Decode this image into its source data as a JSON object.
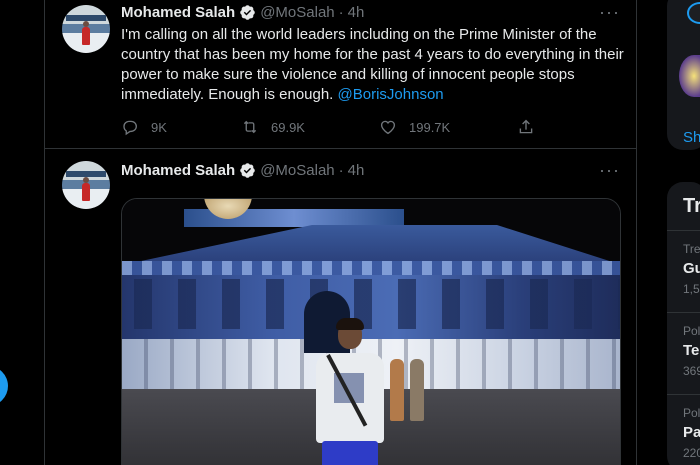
{
  "tweets": [
    {
      "name": "Mohamed Salah",
      "handle": "@MoSalah",
      "separator": "·",
      "time": "4h",
      "text": "I'm calling on all the world leaders including on the Prime Minister of the country that has been my home for the past 4 years to do everything in their power to make sure the violence and killing of innocent people stops immediately. Enough is enough.",
      "mention": "@BorisJohnson",
      "replies": "9K",
      "retweets": "69.9K",
      "likes": "199.7K",
      "more": "···"
    },
    {
      "name": "Mohamed Salah",
      "handle": "@MoSalah",
      "separator": "·",
      "time": "4h",
      "more": "···"
    }
  ],
  "right_sidebar": {
    "show_more_fragment": "Sh",
    "trends_heading_fragment": "Tr",
    "trends": [
      {
        "context": "Tre",
        "title": "Gu",
        "count": "1,5"
      },
      {
        "context": "Pol",
        "title": "Te",
        "count": "369"
      },
      {
        "context": "Pol",
        "title": "Pa",
        "count": "220"
      }
    ]
  },
  "colors": {
    "background": "#000000",
    "accent": "#1d9bf0",
    "text_primary": "#e7e9ea",
    "text_secondary": "#71767b",
    "border": "#2f3336"
  },
  "icons": {
    "verified": "verified-badge-icon",
    "reply": "reply-icon",
    "retweet": "retweet-icon",
    "like": "heart-icon",
    "share": "share-icon",
    "more": "more-dots-icon"
  }
}
